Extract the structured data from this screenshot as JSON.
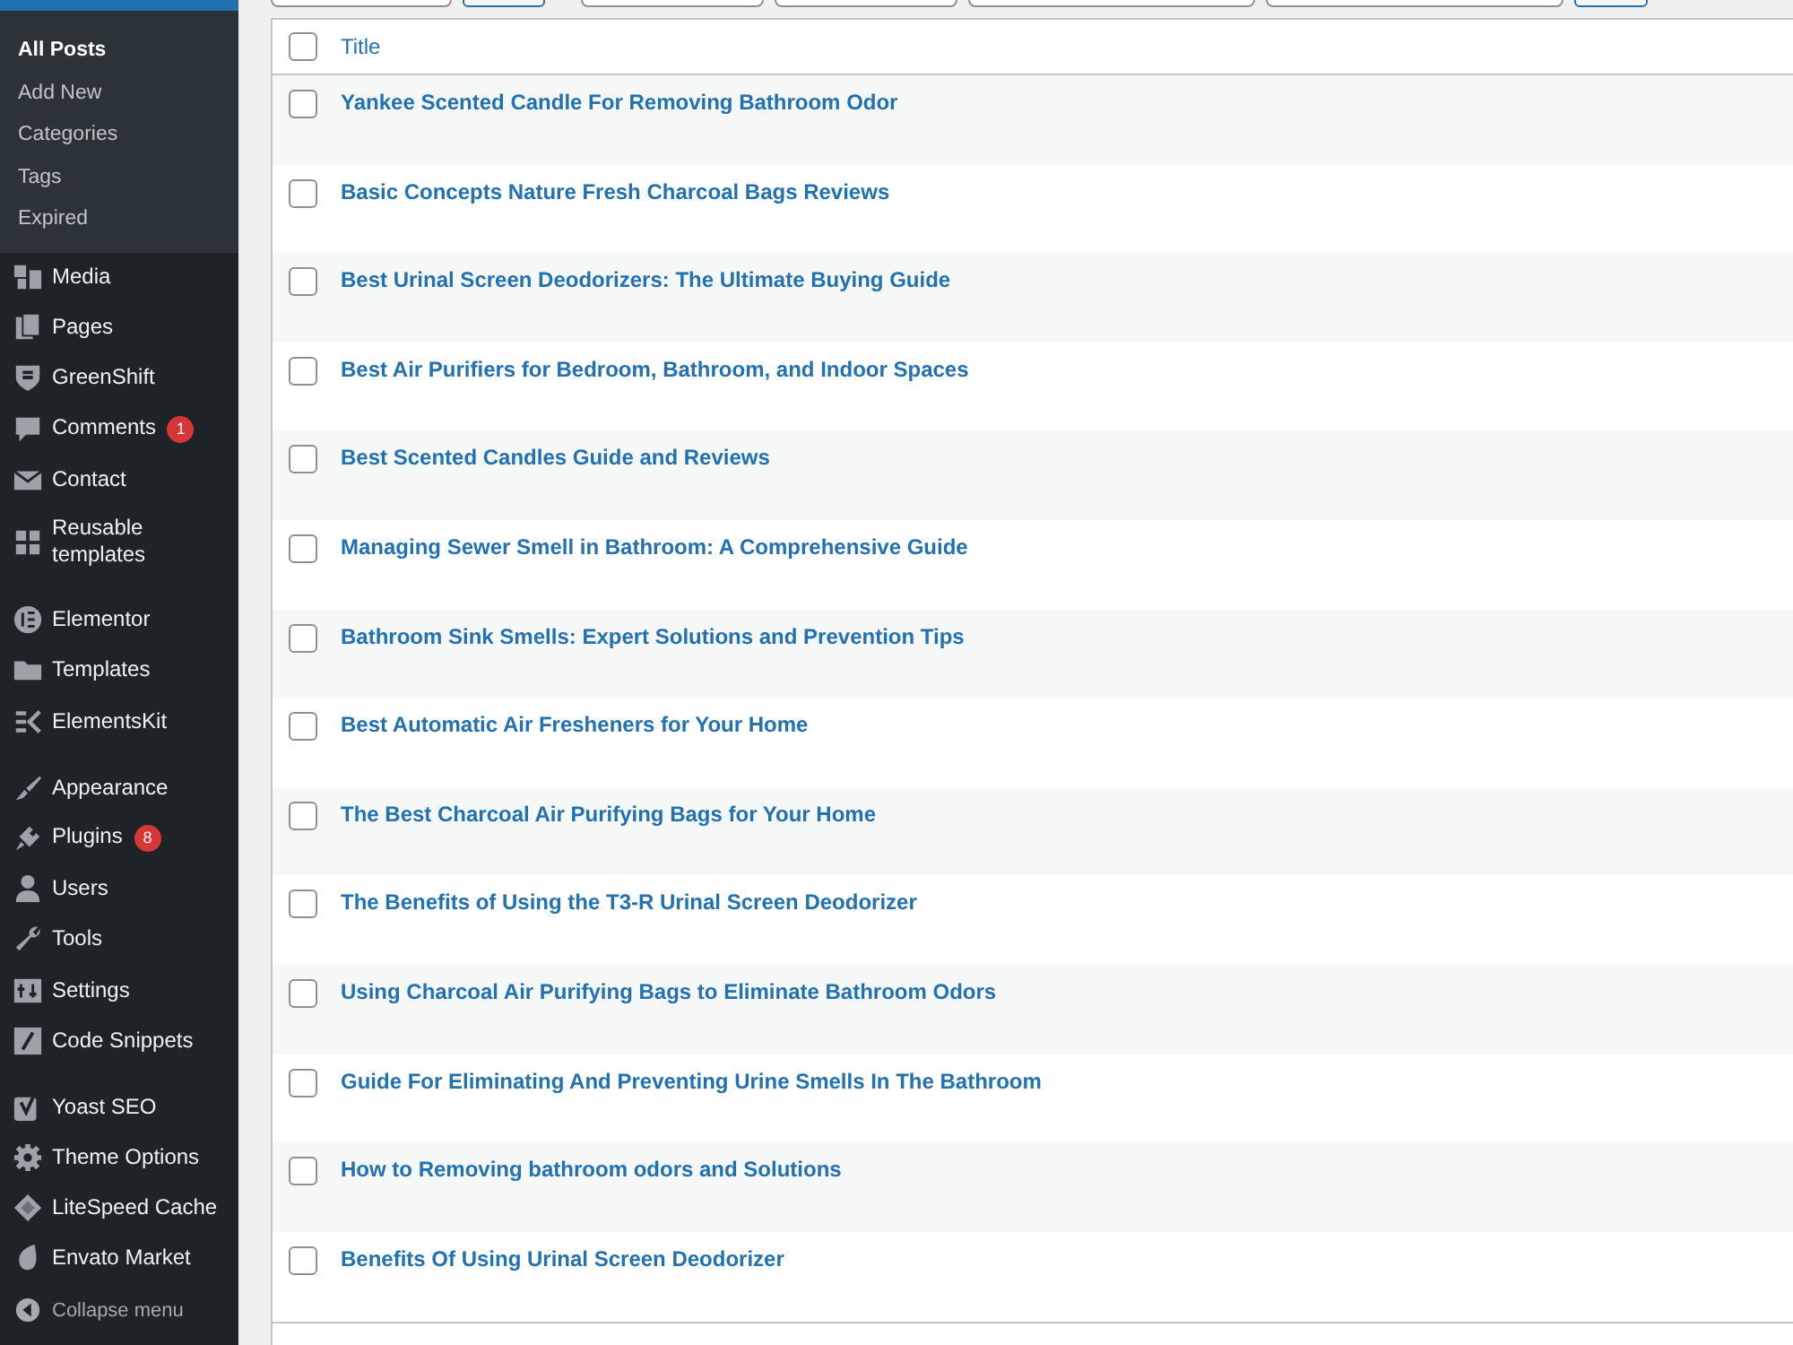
{
  "sidebar": {
    "submenu": [
      {
        "label": "All Posts",
        "selected": true
      },
      {
        "label": "Add New",
        "selected": false
      },
      {
        "label": "Categories",
        "selected": false
      },
      {
        "label": "Tags",
        "selected": false
      },
      {
        "label": "Expired",
        "selected": false
      }
    ],
    "groups": [
      [
        {
          "label": "Media"
        },
        {
          "label": "Pages"
        },
        {
          "label": "GreenShift"
        },
        {
          "label": "Comments",
          "badge": "1"
        },
        {
          "label": "Contact"
        },
        {
          "label": "Reusable templates"
        }
      ],
      [
        {
          "label": "Elementor"
        },
        {
          "label": "Templates"
        },
        {
          "label": "ElementsKit"
        }
      ],
      [
        {
          "label": "Appearance"
        },
        {
          "label": "Plugins",
          "badge": "8"
        },
        {
          "label": "Users"
        },
        {
          "label": "Tools"
        },
        {
          "label": "Settings"
        },
        {
          "label": "Code Snippets"
        }
      ],
      [
        {
          "label": "Yoast SEO"
        },
        {
          "label": "Theme Options"
        },
        {
          "label": "LiteSpeed Cache"
        },
        {
          "label": "Envato Market"
        }
      ]
    ],
    "collapse": "Collapse menu"
  },
  "table": {
    "column": "Title",
    "all_checked": false,
    "rows": [
      {
        "title": "Yankee Scented Candle For Removing Bathroom Odor",
        "checked": false
      },
      {
        "title": "Basic Concepts Nature Fresh Charcoal Bags Reviews",
        "checked": false
      },
      {
        "title": "Best Urinal Screen Deodorizers: The Ultimate Buying Guide",
        "checked": false
      },
      {
        "title": "Best Air Purifiers for Bedroom, Bathroom, and Indoor Spaces",
        "checked": false
      },
      {
        "title": "Best Scented Candles Guide and Reviews",
        "checked": false
      },
      {
        "title": "Managing Sewer Smell in Bathroom: A Comprehensive Guide",
        "checked": false
      },
      {
        "title": "Bathroom Sink Smells: Expert Solutions and Prevention Tips",
        "checked": false
      },
      {
        "title": "Best Automatic Air Fresheners for Your Home",
        "checked": false
      },
      {
        "title": "The Best Charcoal Air Purifying Bags for Your Home",
        "checked": false
      },
      {
        "title": "The Benefits of Using the T3-R Urinal Screen Deodorizer",
        "checked": false
      },
      {
        "title": "Using Charcoal Air Purifying Bags to Eliminate Bathroom Odors",
        "checked": false
      },
      {
        "title": "Guide For Eliminating And Preventing Urine Smells In The Bathroom",
        "checked": false
      },
      {
        "title": "How to Removing bathroom odors and Solutions",
        "checked": false
      },
      {
        "title": "Benefits Of Using Urinal Screen Deodorizer",
        "checked": false
      }
    ]
  }
}
